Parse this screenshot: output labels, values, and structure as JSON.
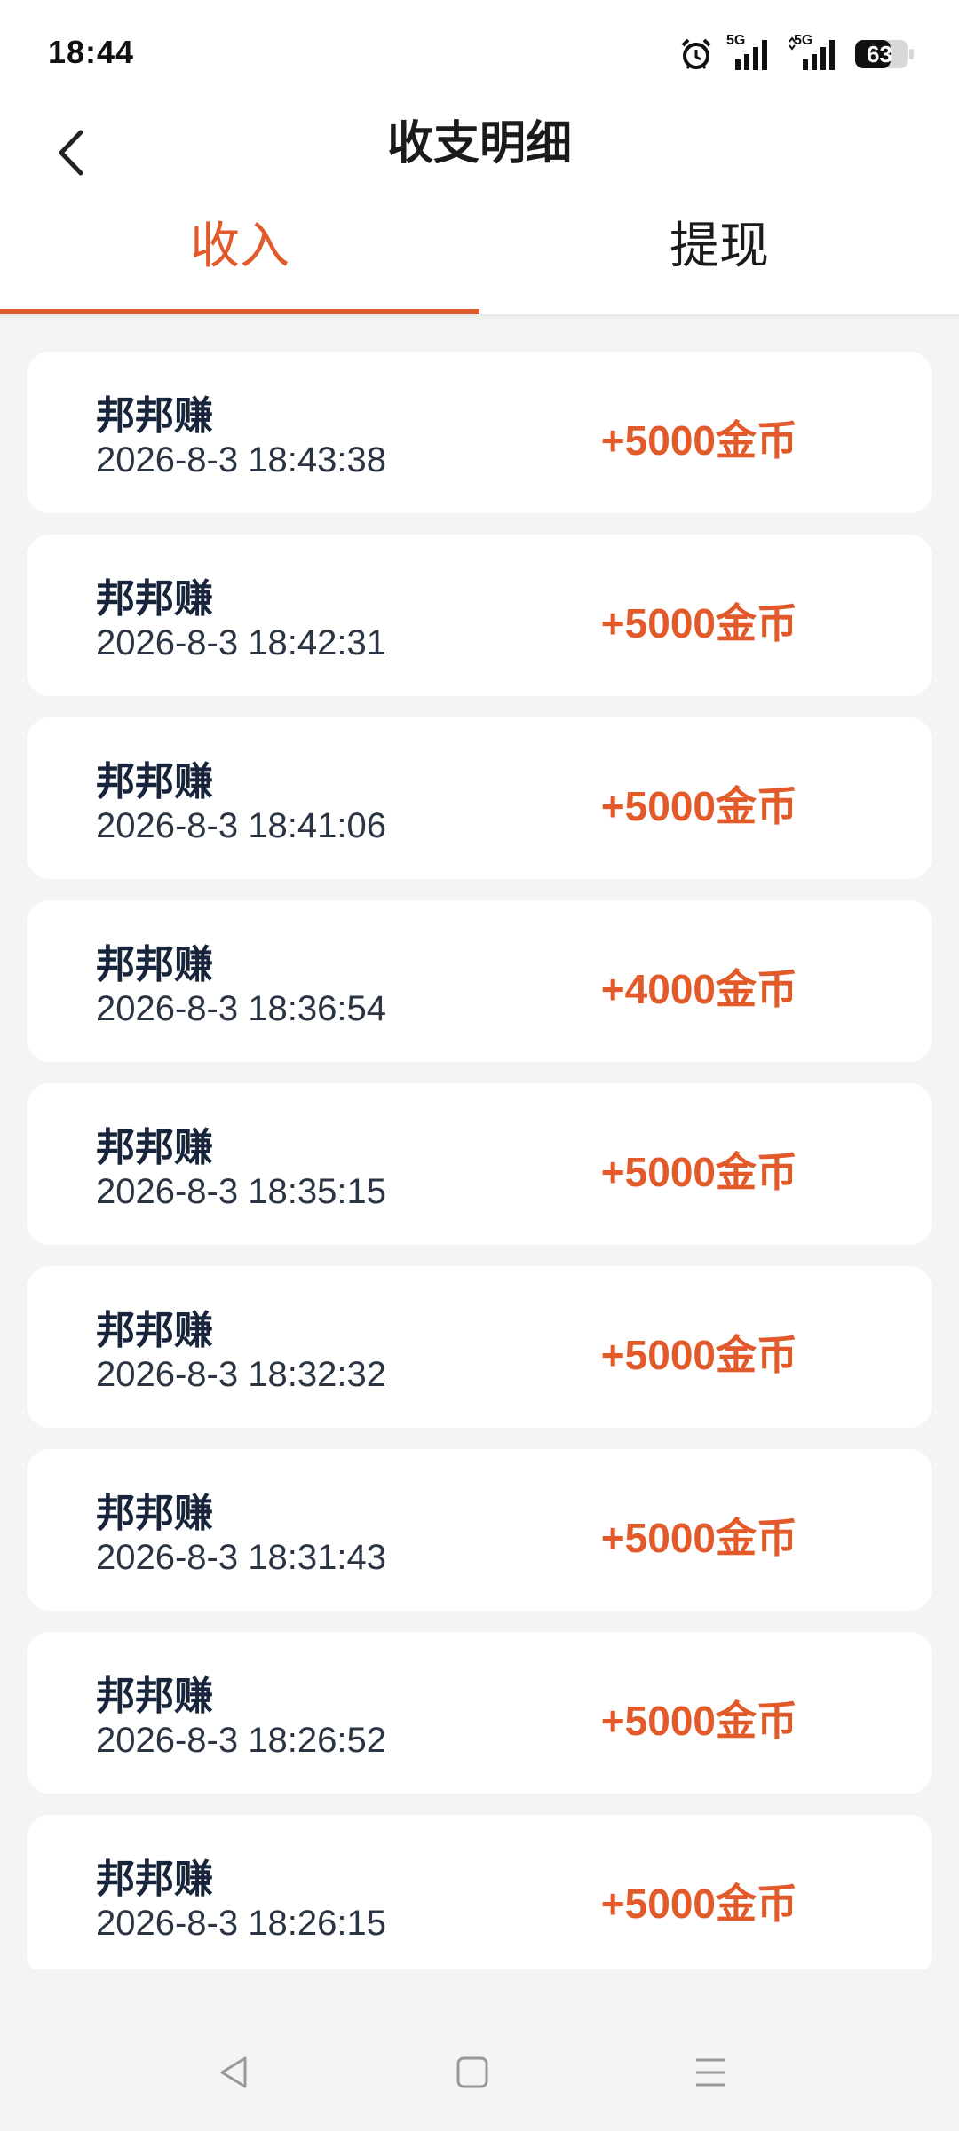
{
  "status_bar": {
    "time": "18:44",
    "network_1": "5G",
    "network_2": "5G",
    "battery": "63",
    "icons": [
      "alarm-icon",
      "signal-icon",
      "signal-icon",
      "battery-icon"
    ]
  },
  "header": {
    "title": "收支明细",
    "back_icon": "chevron-left-icon"
  },
  "tabs": [
    {
      "label": "收入",
      "active": true
    },
    {
      "label": "提现",
      "active": false
    }
  ],
  "records": [
    {
      "name": "邦邦赚",
      "time": "2026-8-3 18:43:38",
      "amount": "+5000金币"
    },
    {
      "name": "邦邦赚",
      "time": "2026-8-3 18:42:31",
      "amount": "+5000金币"
    },
    {
      "name": "邦邦赚",
      "time": "2026-8-3 18:41:06",
      "amount": "+5000金币"
    },
    {
      "name": "邦邦赚",
      "time": "2026-8-3 18:36:54",
      "amount": "+4000金币"
    },
    {
      "name": "邦邦赚",
      "time": "2026-8-3 18:35:15",
      "amount": "+5000金币"
    },
    {
      "name": "邦邦赚",
      "time": "2026-8-3 18:32:32",
      "amount": "+5000金币"
    },
    {
      "name": "邦邦赚",
      "time": "2026-8-3 18:31:43",
      "amount": "+5000金币"
    },
    {
      "name": "邦邦赚",
      "time": "2026-8-3 18:26:52",
      "amount": "+5000金币"
    },
    {
      "name": "邦邦赚",
      "time": "2026-8-3 18:26:15",
      "amount": "+5000金币"
    }
  ],
  "system_nav": [
    "back-triangle-icon",
    "home-square-icon",
    "menu-lines-icon"
  ],
  "colors": {
    "accent": "#e2592a",
    "background": "#f4f4f4",
    "card": "#ffffff",
    "text_dark": "#17243a"
  }
}
